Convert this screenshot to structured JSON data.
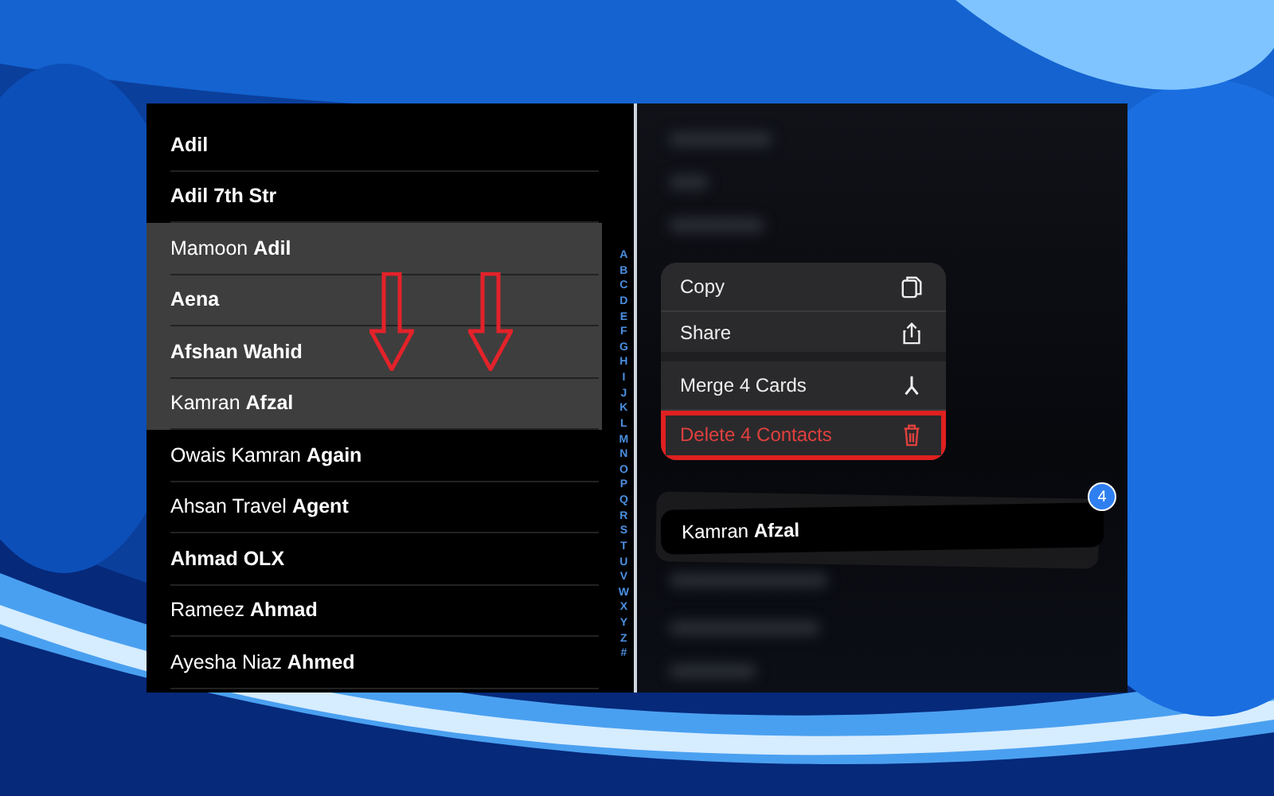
{
  "contacts": [
    {
      "family": "Adil",
      "selected": false
    },
    {
      "family": "Adil 7th Str",
      "selected": false
    },
    {
      "given": "Mamoon",
      "family": "Adil",
      "selected": true
    },
    {
      "family": "Aena",
      "selected": true
    },
    {
      "family": "Afshan Wahid",
      "selected": true
    },
    {
      "given": "Kamran",
      "family": "Afzal",
      "selected": true
    },
    {
      "given": "Owais Kamran",
      "family": "Again",
      "selected": false
    },
    {
      "given": "Ahsan Travel",
      "family": "Agent",
      "selected": false
    },
    {
      "family": "Ahmad OLX",
      "selected": false
    },
    {
      "given": "Rameez",
      "family": "Ahmad",
      "selected": false
    },
    {
      "given": "Ayesha Niaz",
      "family": "Ahmed",
      "selected": false
    }
  ],
  "index": [
    "A",
    "B",
    "C",
    "D",
    "E",
    "F",
    "G",
    "H",
    "I",
    "J",
    "K",
    "L",
    "M",
    "N",
    "O",
    "P",
    "Q",
    "R",
    "S",
    "T",
    "U",
    "V",
    "W",
    "X",
    "Y",
    "Z",
    "#"
  ],
  "arrows": [
    {
      "kind": "down"
    },
    {
      "kind": "down"
    }
  ],
  "menu": [
    {
      "label": "Copy",
      "kind": "copy",
      "destructive": false,
      "outlined": false,
      "group_end": false
    },
    {
      "label": "Share",
      "kind": "share",
      "destructive": false,
      "outlined": false,
      "group_end": true
    },
    {
      "label": "Merge 4 Cards",
      "kind": "merge",
      "destructive": false,
      "outlined": false,
      "group_end": false
    },
    {
      "label": "Delete 4 Contacts",
      "kind": "trash",
      "destructive": true,
      "outlined": true,
      "group_end": false
    }
  ],
  "drag_card": {
    "given": "Kamran",
    "family": "Afzal",
    "count": "4"
  }
}
